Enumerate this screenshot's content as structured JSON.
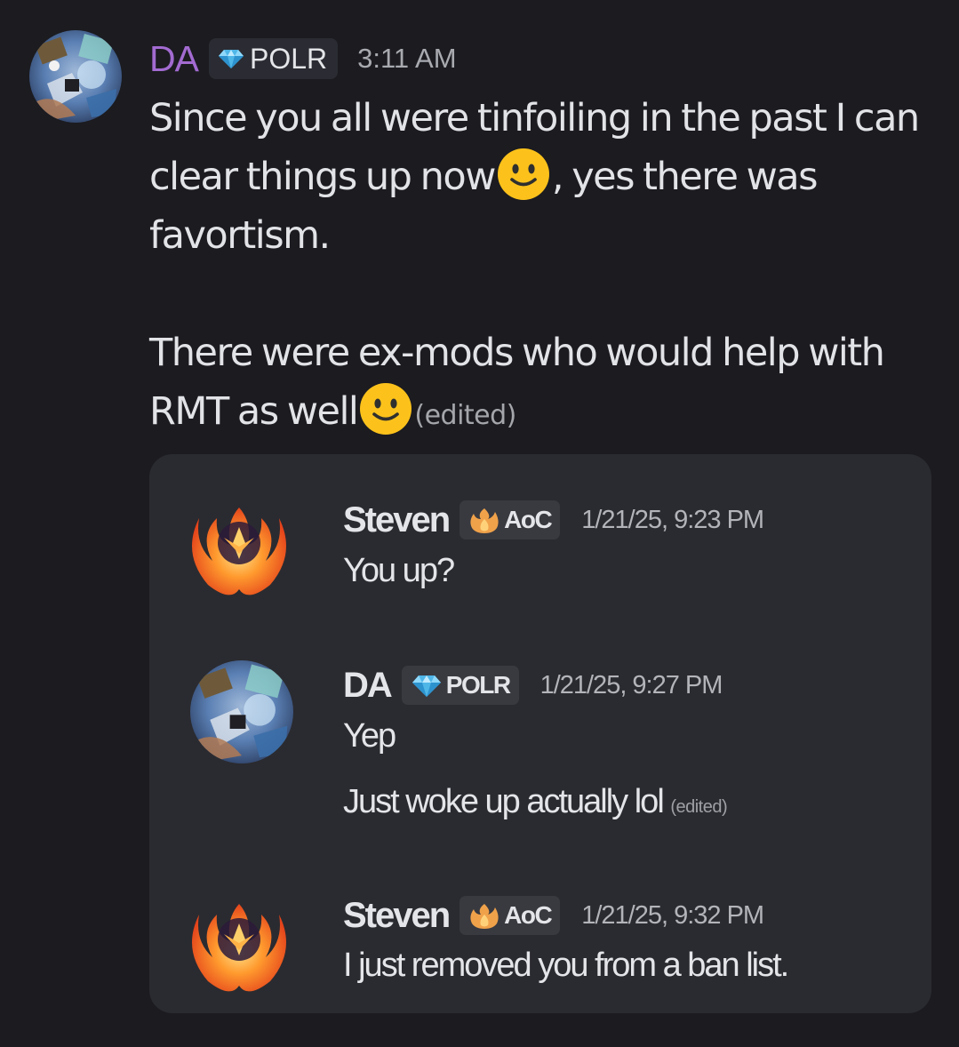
{
  "message": {
    "author": "DA",
    "role_tag": "POLR",
    "timestamp": "3:11 AM",
    "lines": [
      "Since you all were tinfoiling in the past I can",
      "clear things up now",
      ", yes there was",
      "favortism.",
      "There were ex-mods who would help with",
      "RMT as well"
    ],
    "emoji": "slightly-smiling-face",
    "edited_label": "(edited)",
    "colors": {
      "author": "#a36bd1",
      "background": "#1b1b20",
      "text": "#e2e3e6"
    }
  },
  "embedded_screenshot": {
    "background": "#2a2b30",
    "messages": [
      {
        "author": "Steven",
        "role_tag": "AoC",
        "role_icon": "flame-icon",
        "timestamp": "1/21/25, 9:23 PM",
        "lines": [
          "You up?"
        ]
      },
      {
        "author": "DA",
        "role_tag": "POLR",
        "role_icon": "diamond-icon",
        "timestamp": "1/21/25, 9:27 PM",
        "lines": [
          "Yep",
          "Just woke up actually lol"
        ],
        "edited_label": "(edited)"
      },
      {
        "author": "Steven",
        "role_tag": "AoC",
        "role_icon": "flame-icon",
        "timestamp": "1/21/25, 9:32 PM",
        "lines": [
          "I just removed you from a ban list."
        ]
      }
    ]
  }
}
